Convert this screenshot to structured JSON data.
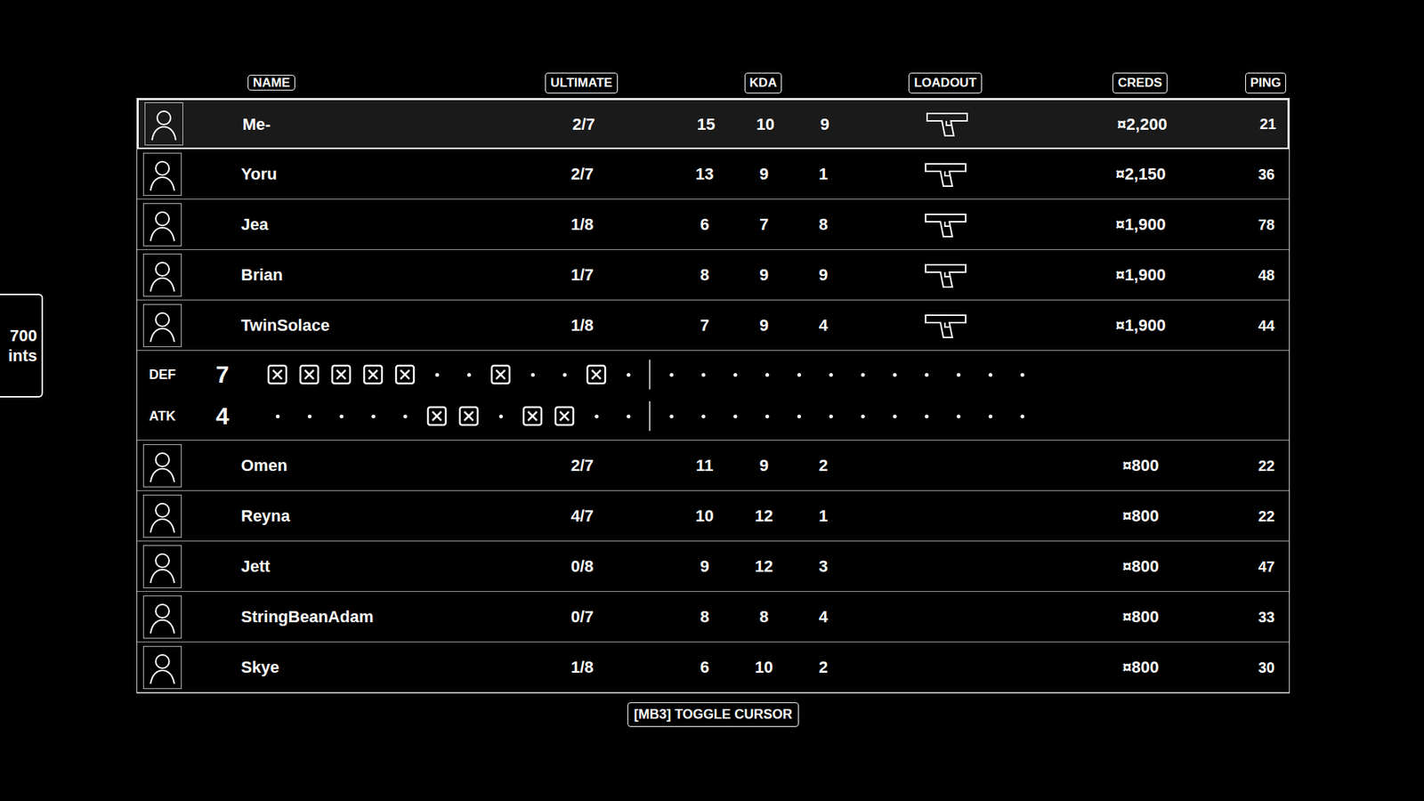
{
  "columns": {
    "name": "NAME",
    "ultimate": "ULTIMATE",
    "kda": "KDA",
    "loadout": "LOADOUT",
    "creds": "CREDS",
    "ping": "PING"
  },
  "teams": [
    {
      "side": "top",
      "players": [
        {
          "name": "Me-",
          "ultimate": "2/7",
          "kills": "15",
          "deaths": "10",
          "assists": "9",
          "creds": "¤2,200",
          "ping": "21",
          "selected": true,
          "has_loadout": true
        },
        {
          "name": "Yoru",
          "ultimate": "2/7",
          "kills": "13",
          "deaths": "9",
          "assists": "1",
          "creds": "¤2,150",
          "ping": "36",
          "selected": false,
          "has_loadout": true
        },
        {
          "name": "Jea",
          "ultimate": "1/8",
          "kills": "6",
          "deaths": "7",
          "assists": "8",
          "creds": "¤1,900",
          "ping": "78",
          "selected": false,
          "has_loadout": true
        },
        {
          "name": "Brian",
          "ultimate": "1/7",
          "kills": "8",
          "deaths": "9",
          "assists": "9",
          "creds": "¤1,900",
          "ping": "48",
          "selected": false,
          "has_loadout": true
        },
        {
          "name": "TwinSolace",
          "ultimate": "1/8",
          "kills": "7",
          "deaths": "9",
          "assists": "4",
          "creds": "¤1,900",
          "ping": "44",
          "selected": false,
          "has_loadout": true
        }
      ]
    },
    {
      "side": "bottom",
      "players": [
        {
          "name": "Omen",
          "ultimate": "2/7",
          "kills": "11",
          "deaths": "9",
          "assists": "2",
          "creds": "¤800",
          "ping": "22",
          "selected": false,
          "has_loadout": false
        },
        {
          "name": "Reyna",
          "ultimate": "4/7",
          "kills": "10",
          "deaths": "12",
          "assists": "1",
          "creds": "¤800",
          "ping": "22",
          "selected": false,
          "has_loadout": false
        },
        {
          "name": "Jett",
          "ultimate": "0/8",
          "kills": "9",
          "deaths": "12",
          "assists": "3",
          "creds": "¤800",
          "ping": "47",
          "selected": false,
          "has_loadout": false
        },
        {
          "name": "StringBeanAdam",
          "ultimate": "0/7",
          "kills": "8",
          "deaths": "8",
          "assists": "4",
          "creds": "¤800",
          "ping": "33",
          "selected": false,
          "has_loadout": false
        },
        {
          "name": "Skye",
          "ultimate": "1/8",
          "kills": "6",
          "deaths": "10",
          "assists": "2",
          "creds": "¤800",
          "ping": "30",
          "selected": false,
          "has_loadout": false
        }
      ]
    }
  ],
  "round_tracker": {
    "rows": [
      {
        "label": "DEF",
        "score": "7",
        "side": "def"
      },
      {
        "label": "ATK",
        "score": "4",
        "side": "atk"
      }
    ],
    "rounds": [
      {
        "winner": "def"
      },
      {
        "winner": "def"
      },
      {
        "winner": "def"
      },
      {
        "winner": "def"
      },
      {
        "winner": "def"
      },
      {
        "winner": "atk"
      },
      {
        "winner": "atk"
      },
      {
        "winner": "def"
      },
      {
        "winner": "atk"
      },
      {
        "winner": "atk"
      },
      {
        "winner": "def"
      },
      {
        "winner": null
      },
      {
        "winner": null
      },
      {
        "winner": null
      },
      {
        "winner": null
      },
      {
        "winner": null
      },
      {
        "winner": null
      },
      {
        "winner": null
      },
      {
        "winner": null
      },
      {
        "winner": null
      },
      {
        "winner": null
      },
      {
        "winner": null
      },
      {
        "winner": null
      },
      {
        "winner": null
      }
    ]
  },
  "hint": "[MB3] TOGGLE CURSOR",
  "side_badge": {
    "lines": [
      "700",
      "ints"
    ]
  }
}
